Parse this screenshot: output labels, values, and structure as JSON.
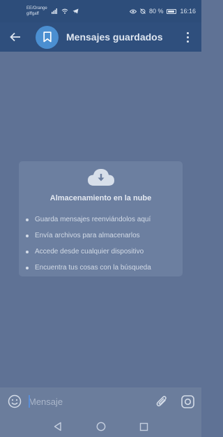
{
  "status_bar": {
    "carrier_line1": "EE/Orange",
    "carrier_line2": "giffgaff",
    "battery_text": "80 %",
    "time": "16:16",
    "icons": [
      "signal-icon",
      "wifi-icon",
      "telegram-icon",
      "eye-icon",
      "alarm-off-icon",
      "battery-icon"
    ]
  },
  "toolbar": {
    "title": "Mensajes guardados",
    "back_icon": "arrow-left-icon",
    "avatar_icon": "bookmark-icon",
    "menu_icon": "kebab-menu-icon"
  },
  "empty_state": {
    "icon": "cloud-download-icon",
    "title": "Almacenamiento en la nube",
    "items": [
      "Guarda mensajes reenviándolos aquí",
      "Envía archivos para almacenarlos",
      "Accede desde cualquier dispositivo",
      "Encuentra tus cosas con la búsqueda"
    ]
  },
  "composer": {
    "placeholder": "Mensaje",
    "emoji_icon": "emoji-icon",
    "attach_icon": "paperclip-icon",
    "camera_icon": "camera-icon"
  },
  "nav_bar": {
    "icons": [
      "back-triangle-icon",
      "home-circle-icon",
      "recents-square-icon"
    ]
  },
  "colors": {
    "accent": "#4b8fd1",
    "toolbar": "#2f4f7d",
    "background": "#5f7295"
  }
}
